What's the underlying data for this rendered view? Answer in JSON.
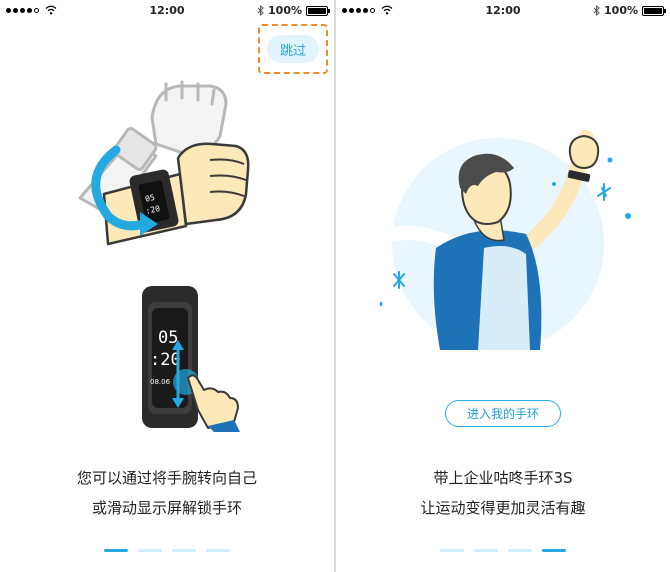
{
  "status_bar": {
    "time": "12:00",
    "battery": "100%"
  },
  "left_screen": {
    "skip_label": "跳过",
    "band_display": {
      "hour": "05",
      "minute": ":20",
      "small_time": "08.06"
    },
    "large_display": {
      "hour": "05",
      "minute": ":20",
      "small_time": "08.06"
    },
    "caption_line1": "您可以通过将手腕转向自己",
    "caption_line2": "或滑动显示屏解锁手环",
    "page_index": 1,
    "page_count": 4
  },
  "right_screen": {
    "enter_label": "进入我的手环",
    "caption_line1": "带上企业咕咚手环3S",
    "caption_line2": "让运动变得更加灵活有趣",
    "page_index": 4,
    "page_count": 4
  },
  "colors": {
    "accent": "#24a9e1",
    "skip_highlight": "#f08a2a",
    "skin": "#fce8b8",
    "band_dark": "#2b2b2b",
    "shirt_blue": "#1d72b8"
  }
}
